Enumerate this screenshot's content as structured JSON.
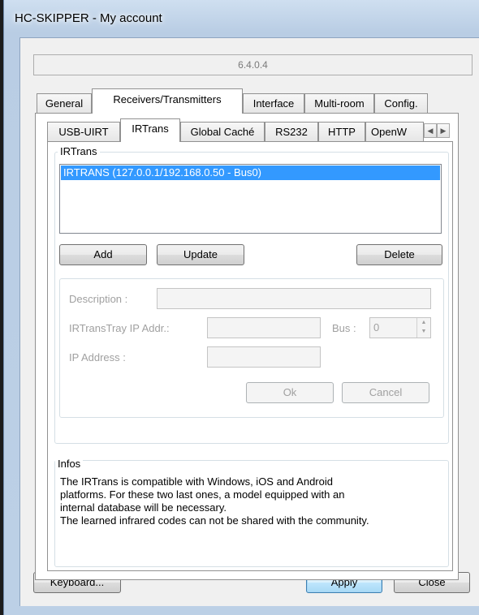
{
  "window": {
    "title": "HC-SKIPPER - My account"
  },
  "version": "6.4.0.4",
  "main_tabs": [
    {
      "label": "General"
    },
    {
      "label": "Receivers/Transmitters"
    },
    {
      "label": "Interface"
    },
    {
      "label": "Multi-room"
    },
    {
      "label": "Config."
    }
  ],
  "sub_tabs": [
    {
      "label": "USB-UIRT"
    },
    {
      "label": "IRTrans"
    },
    {
      "label": "Global Caché"
    },
    {
      "label": "RS232"
    },
    {
      "label": "HTTP"
    },
    {
      "label": "OpenW"
    }
  ],
  "irtrans_group": {
    "label": "IRTrans",
    "items": [
      "IRTRANS (127.0.0.1/192.168.0.50 - Bus0)"
    ],
    "add_label": "Add",
    "update_label": "Update",
    "delete_label": "Delete"
  },
  "form": {
    "description_label": "Description :",
    "description_value": "",
    "tray_ip_label": "IRTransTray IP Addr.:",
    "tray_ip_value": "",
    "bus_label": "Bus :",
    "bus_value": "0",
    "ip_label": "IP Address :",
    "ip_value": "",
    "ok_label": "Ok",
    "cancel_label": "Cancel"
  },
  "infos": {
    "label": "Infos",
    "line1": "The IRTrans is compatible with Windows, iOS and Android",
    "line2": "platforms. For these two last ones, a model equipped with an",
    "line3": "internal database will be necessary.",
    "line4": "The learned infrared codes can not be shared with the community."
  },
  "footer": {
    "keyboard_label": "Keyboard...",
    "apply_label": "Apply",
    "close_label": "Close"
  },
  "icons": {
    "scroll_left": "scroll-left-arrow-icon",
    "scroll_right": "scroll-right-arrow-icon",
    "spin_up": "spin-up-icon",
    "spin_down": "spin-down-icon"
  }
}
